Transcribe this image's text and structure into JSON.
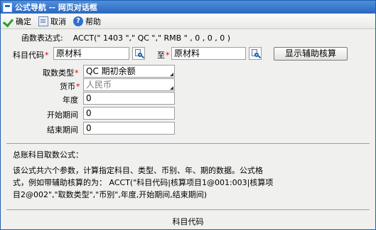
{
  "window": {
    "title": "公式导航 -- 网页对话框"
  },
  "toolbar": {
    "ok_label": "确定",
    "cancel_label": "取消",
    "help_label": "帮助"
  },
  "formula": {
    "label": "函数表达式:",
    "expression": "ACCT(\" 1403 \",\" QC \",\" RMB \" , 0 , 0 , 0 )"
  },
  "fields": {
    "account_label": "科目代码",
    "account_from": "原材料",
    "to_label": "至",
    "account_to": "原材料",
    "show_aux_button": "显示辅助核算",
    "fetch_type_label": "取数类型",
    "fetch_type_value": "QC 期初余额",
    "currency_label": "货币",
    "currency_value": "人民币",
    "year_label": "年度",
    "year_value": "0",
    "start_period_label": "开始期间",
    "start_period_value": "0",
    "end_period_label": "结束期间",
    "end_period_value": "0",
    "required_mark": "*"
  },
  "description": {
    "title": "总账科目取数公式：",
    "line1": "该公式共六个参数，计算指定科目、类型、币别、年、期的数据。公式格",
    "line2": "式，例如带辅助核算的为： ACCT(\"科目代码|核算项目1@001:003|核算项",
    "line3": "目2@002\",\"取数类型\",\"币别\",年度,开始期间,结束期间)"
  },
  "footer": {
    "label": "科目代码"
  }
}
